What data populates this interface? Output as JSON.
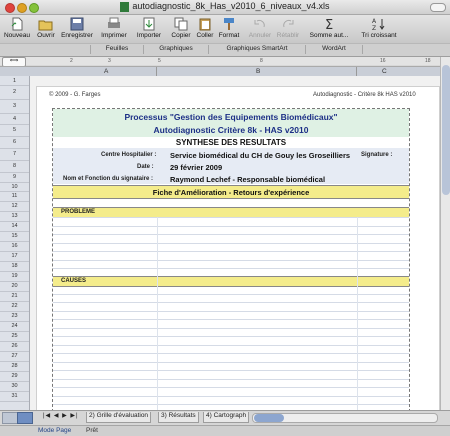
{
  "window": {
    "title": "autodiagnostic_8k_Has_v2010_6_niveaux_v4.xls"
  },
  "toolbar": {
    "new": "Nouveau",
    "open": "Ouvrir",
    "save": "Enregistrer",
    "print": "Imprimer",
    "import": "Importer",
    "copy": "Copier",
    "paste": "Coller",
    "format": "Format",
    "undo": "Annuler",
    "redo": "Rétablir",
    "autosum": "Somme aut...",
    "sort": "Tri croissant"
  },
  "ribbon": {
    "tabs": [
      "Feuilles",
      "Graphiques",
      "Graphiques SmartArt",
      "WordArt"
    ]
  },
  "grid": {
    "columns": [
      "A",
      "B",
      "C"
    ],
    "ruler_marks": [
      "1",
      "2",
      "3",
      "4",
      "5",
      "6",
      "7",
      "8",
      "9",
      "10",
      "11",
      "12",
      "13",
      "14",
      "15",
      "16",
      "17",
      "18"
    ],
    "rows": [
      "1",
      "2",
      "3",
      "4",
      "5",
      "6",
      "7",
      "8",
      "9",
      "10",
      "11",
      "12",
      "13",
      "14",
      "15",
      "16",
      "17",
      "18",
      "19",
      "20",
      "21",
      "22",
      "23",
      "24",
      "25",
      "26",
      "27",
      "28",
      "29",
      "30",
      "31",
      "32",
      "33",
      "34",
      "35"
    ]
  },
  "page": {
    "header_left": "© 2009 - G. Farges",
    "header_right": "Autodiagnostic - Critère 8k HAS v2010",
    "title1": "Processus \"Gestion des Equipements Biomédicaux\"",
    "title2": "Autodiagnostic Critère 8k - HAS v2010",
    "title3": "SYNTHESE DES RESULTATS",
    "centre_label": "Centre Hospitalier :",
    "centre_value": "Service biomédical du CH de Gouy les Groseilliers",
    "signature_label": "Signature :",
    "date_label": "Date :",
    "date_value": "29 février 2009",
    "signataire_label": "Nom et Fonction du signataire :",
    "signataire_value": "Raymond Lechef - Responsable biomédical",
    "fiche": "Fiche d'Amélioration - Retours d'expérience",
    "probleme": "PROBLEME",
    "causes": "CAUSES"
  },
  "sheet_tabs": [
    "2) Grille d'évaluation",
    "3) Résultats",
    "4) Cartograph"
  ],
  "status": {
    "mode": "Mode Page",
    "state": "Prêt"
  },
  "colors": {
    "accent_green": "#dff1e4",
    "highlight_yellow": "#f4ec8b",
    "title_blue": "#1c2f86"
  }
}
